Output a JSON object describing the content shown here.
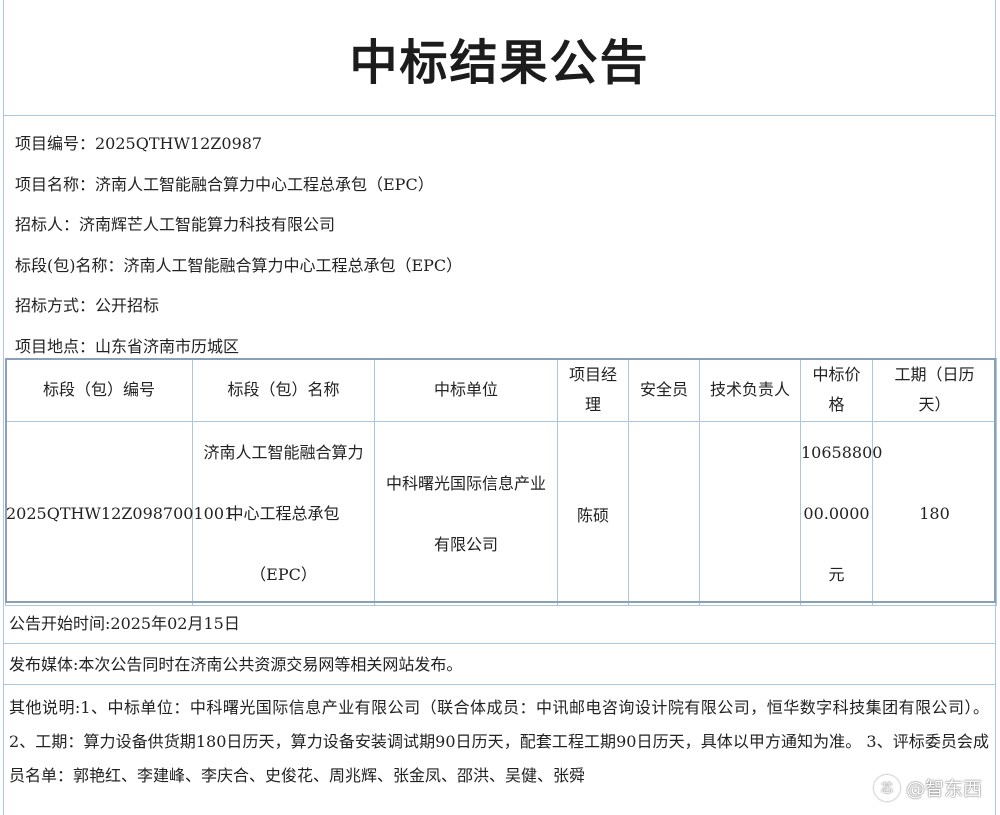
{
  "title": "中标结果公告",
  "info": {
    "project_no": "项目编号：2025QTHW12Z0987",
    "project_name": "项目名称：济南人工智能融合算力中心工程总承包（EPC）",
    "tenderer": "招标人：济南辉芒人工智能算力科技有限公司",
    "lot_name": "标段(包)名称：济南人工智能融合算力中心工程总承包（EPC）",
    "tender_method": "招标方式：公开招标",
    "location": "项目地点：山东省济南市历城区"
  },
  "table": {
    "headers": {
      "lot_no": "标段（包）编号",
      "lot_name": "标段（包）名称",
      "winner": "中标单位",
      "pm_line1": "项目经",
      "pm_line2": "理",
      "safety": "安全员",
      "tech_lead": "技术负责人",
      "price_line1": "中标价",
      "price_line2": "格",
      "period_line1": "工期（日历",
      "period_line2": "天）"
    },
    "row": {
      "lot_no": "2025QTHW12Z0987001001",
      "lot_name_line1": "济南人工智能融合算力",
      "lot_name_line2": "中心工程总承包",
      "lot_name_line3": "（EPC）",
      "winner_line1": "中科曙光国际信息产业",
      "winner_line2": "有限公司",
      "pm": "陈硕",
      "safety": "",
      "tech_lead": "",
      "price_line1": "10658800",
      "price_line2": "00.0000",
      "price_line3": "元",
      "period": "180"
    }
  },
  "publish_time": "公告开始时间:2025年02月15日",
  "publish_media": "发布媒体:本次公告同时在济南公共资源交易网等相关网站发布。",
  "other_notes": "其他说明:1、中标单位：中科曙光国际信息产业有限公司（联合体成员：中讯邮电咨询设计院有限公司，恒华数字科技集团有限公司）。 2、工期：算力设备供货期180日历天，算力设备安装调试期90日历天，配套工程工期90日历天，具体以甲方通知为准。 3、评标委员会成员名单：郭艳红、李建峰、李庆合、史俊花、周兆辉、张金凤、邵洪、吴健、张舜",
  "watermark": {
    "logo_text": "芯",
    "text": "@智东西"
  }
}
